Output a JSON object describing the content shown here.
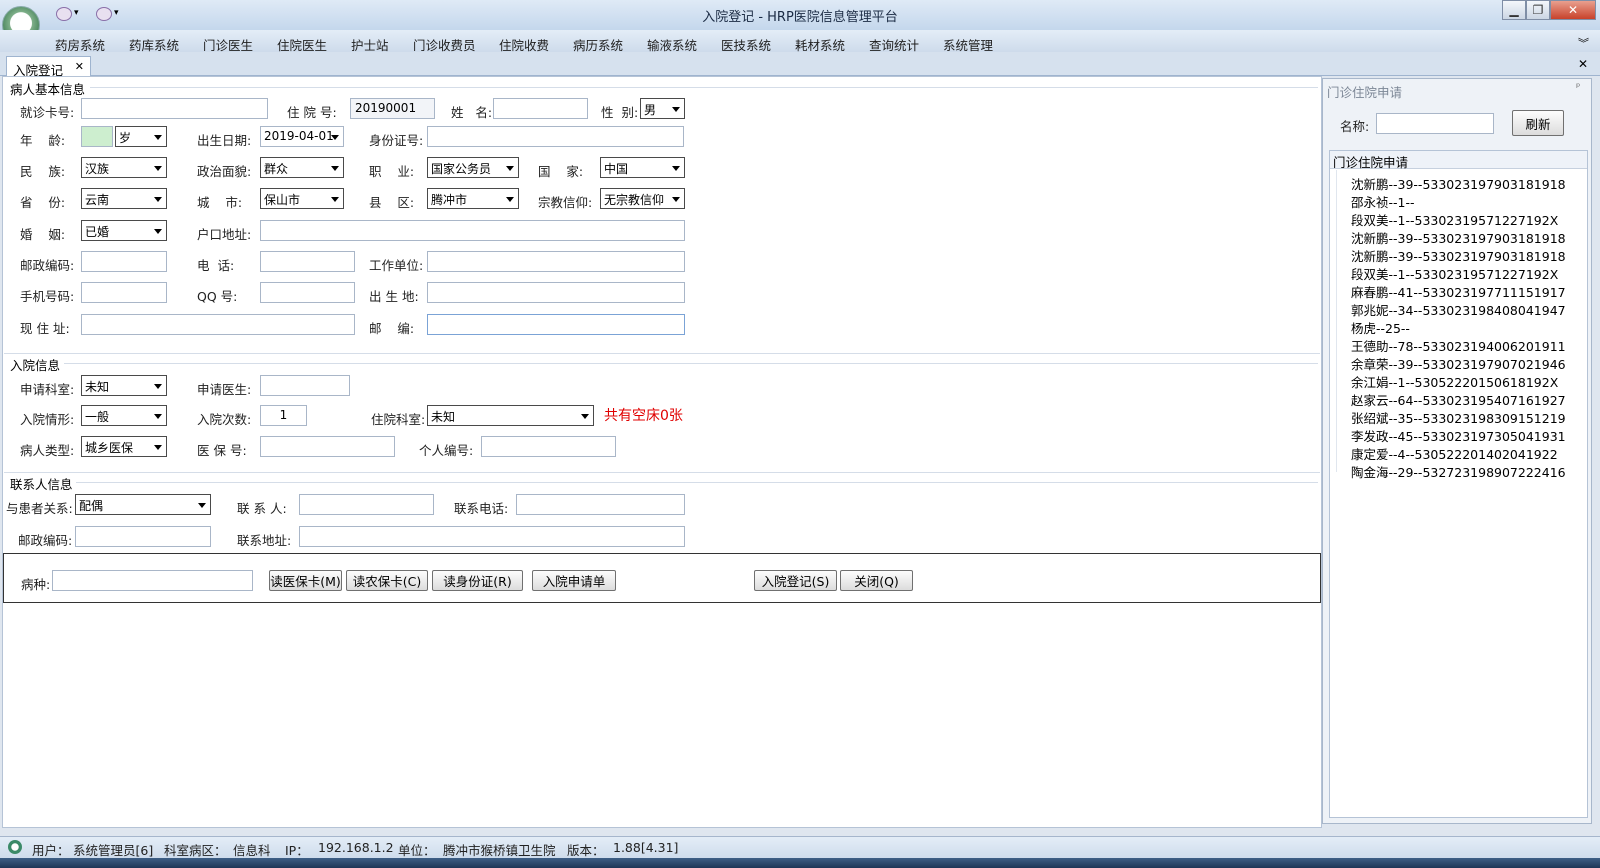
{
  "window": {
    "title": "入院登记 - HRP医院信息管理平台"
  },
  "menu": [
    "药房系统",
    "药库系统",
    "门诊医生",
    "住院医生",
    "护士站",
    "门诊收费员",
    "住院收费",
    "病历系统",
    "输液系统",
    "医技系统",
    "耗材系统",
    "查询统计",
    "系统管理"
  ],
  "tab": {
    "label": "入院登记",
    "close": "✕"
  },
  "basic": {
    "section": "病人基本信息",
    "card_no": "就诊卡号:",
    "hosp_no_label": "住 院 号:",
    "hosp_no": "20190001",
    "name": "姓   名:",
    "gender_label": "性  别:",
    "gender": "男",
    "age_label": "年    龄:",
    "age_unit": "岁",
    "birth_label": "出生日期:",
    "birth": "2019-04-01",
    "id_label": "身份证号:",
    "nation_label": "民    族:",
    "nation": "汉族",
    "political_label": "政治面貌:",
    "political": "群众",
    "job_label": "职    业:",
    "job": "国家公务员",
    "country_label": "国    家:",
    "country": "中国",
    "province_label": "省    份:",
    "province": "云南",
    "city_label": "城    市:",
    "city": "保山市",
    "county_label": "县    区:",
    "county": "腾冲市",
    "religion_label": "宗教信仰:",
    "religion": "无宗教信仰",
    "marriage_label": "婚    姻:",
    "marriage": "已婚",
    "hukou_label": "户口地址:",
    "postcode_label": "邮政编码:",
    "phone_label": "电  话:",
    "work_label": "工作单位:",
    "mobile_label": "手机号码:",
    "qq_label": "QQ 号:",
    "birthplace_label": "出 生 地:",
    "address_label": "现 住 址:",
    "zip_label": "邮    编:"
  },
  "admit": {
    "section": "入院信息",
    "dept_label": "申请科室:",
    "dept": "未知",
    "doctor_label": "申请医生:",
    "situation_label": "入院情形:",
    "situation": "一般",
    "times_label": "入院次数:",
    "times": "1",
    "ward_label": "住院科室:",
    "ward": "未知",
    "beds": "共有空床0张",
    "type_label": "病人类型:",
    "type": "城乡医保",
    "insure_label": "医 保 号:",
    "personal_label": "个人编号:"
  },
  "contact": {
    "section": "联系人信息",
    "relation_label": "与患者关系:",
    "relation": "配偶",
    "person_label": "联 系 人:",
    "phone_label": "联系电话:",
    "postcode_label": "邮政编码:",
    "address_label": "联系地址:"
  },
  "actions": {
    "disease_label": "病种:",
    "read_med": "读医保卡(M)",
    "read_rural": "读农保卡(C)",
    "read_id": "读身份证(R)",
    "apply_form": "入院申请单",
    "register": "入院登记(S)",
    "close": "关闭(Q)"
  },
  "right": {
    "title": "门诊住院申请",
    "pin": "ᵖ",
    "name_label": "名称:",
    "refresh": "刷新",
    "list_title": "门诊住院申请",
    "items": [
      "沈新鹏--39--533023197903181918",
      "邵永祯--1--",
      "段双美--1--53302319571227192X",
      "沈新鹏--39--533023197903181918",
      "沈新鹏--39--533023197903181918",
      "段双美--1--53302319571227192X",
      "麻春鹏--41--533023197711151917",
      "郭兆妮--34--533023198408041947",
      "杨虎--25--",
      "王德助--78--533023194006201911",
      "余章荣--39--533023197907021946",
      "余江娟--1--53052220150618192X",
      "赵家云--64--533023195407161927",
      "张绍斌--35--533023198309151219",
      "李发政--45--533023197305041931",
      "康定爱--4--530522201402041922",
      "陶金海--29--532723198907222416"
    ]
  },
  "status": {
    "user_label": "用户：",
    "user": "系统管理员[6]",
    "dept_label": "科室病区：",
    "dept": "信息科",
    "ip_label": "IP：",
    "ip": "192.168.1.2",
    "unit_label": "单位：",
    "unit": "腾冲市猴桥镇卫生院",
    "version_label": "版本：",
    "version": "1.88[4.31]"
  }
}
